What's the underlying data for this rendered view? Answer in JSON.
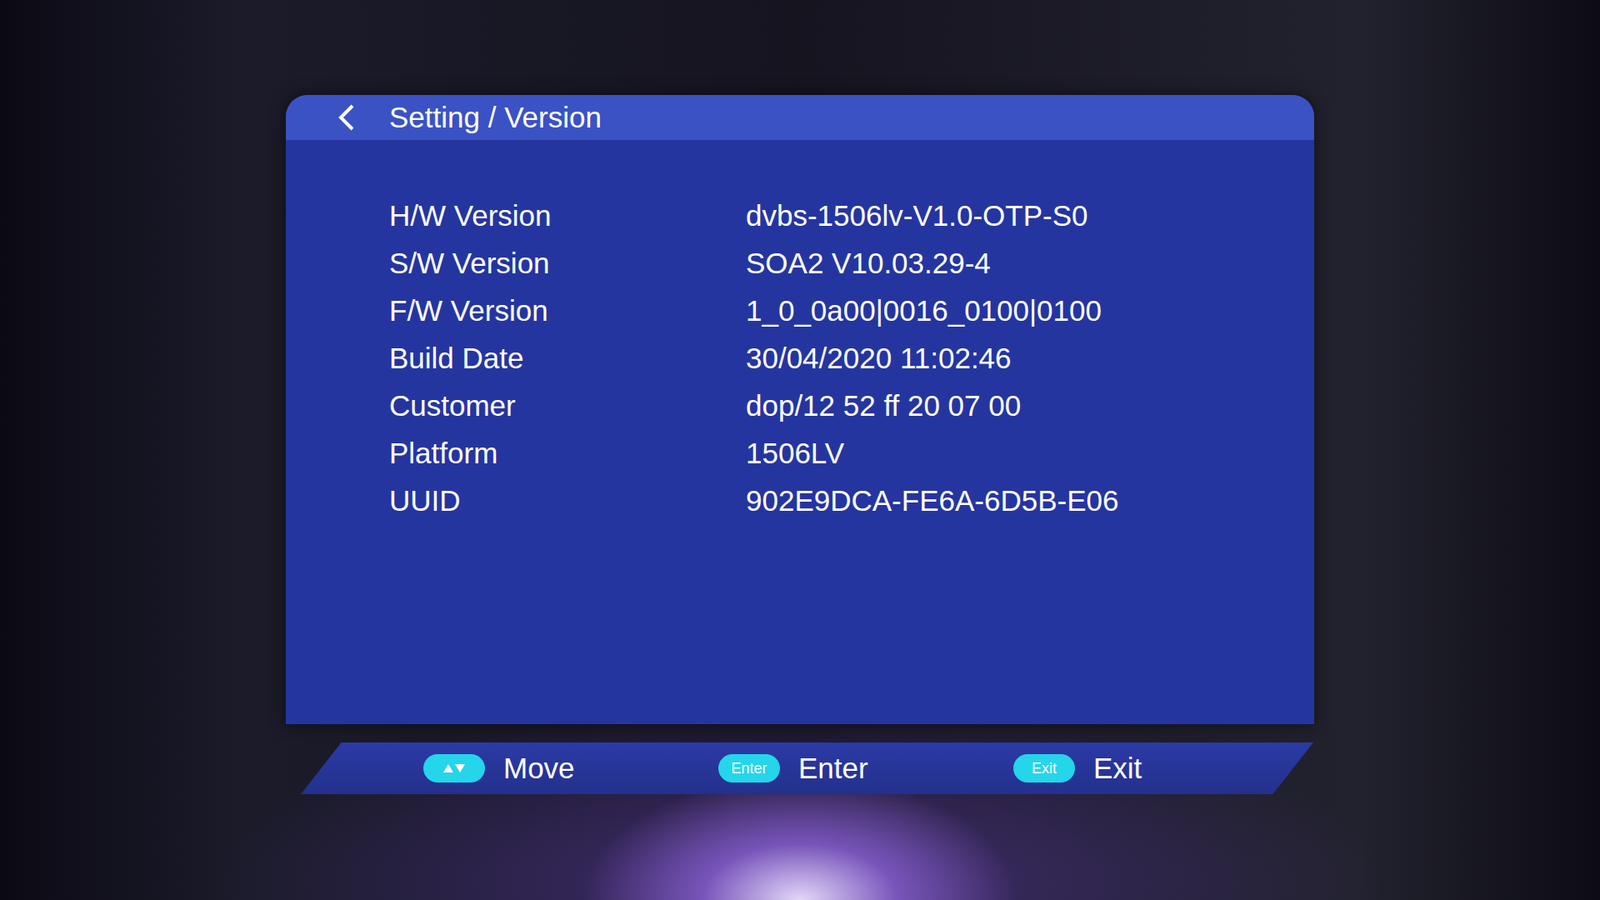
{
  "header": {
    "title": "Setting / Version"
  },
  "info": [
    {
      "label": "H/W Version",
      "value": "dvbs-1506lv-V1.0-OTP-S0"
    },
    {
      "label": "S/W Version",
      "value": "SOA2 V10.03.29-4"
    },
    {
      "label": "F/W Version",
      "value": "1_0_0a00|0016_0100|0100"
    },
    {
      "label": "Build Date",
      "value": "30/04/2020 11:02:46"
    },
    {
      "label": "Customer",
      "value": "dop/12 52 ff 20 07 00"
    },
    {
      "label": "Platform",
      "value": "1506LV"
    },
    {
      "label": "UUID",
      "value": "902E9DCA-FE6A-6D5B-E06"
    }
  ],
  "hints": [
    {
      "kind": "arrows",
      "key": "",
      "label": "Move"
    },
    {
      "kind": "text",
      "key": "Enter",
      "label": "Enter"
    },
    {
      "kind": "text",
      "key": "Exit",
      "label": "Exit"
    }
  ]
}
